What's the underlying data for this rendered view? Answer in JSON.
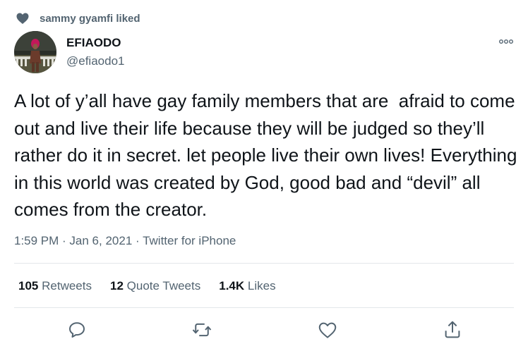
{
  "social_context": {
    "text": "sammy gyamfi liked",
    "icon": "heart-icon"
  },
  "author": {
    "name": "EFIAODO",
    "handle": "@efiaodo1"
  },
  "tweet": {
    "text": "A lot of y’all have gay family members that are  afraid to come out and live their life because they will be judged so they’ll rather do it in secret. let people live their own lives! Everything in this world was created by God, good bad and “devil” all comes from the creator."
  },
  "meta": {
    "text": "1:59 PM · Jan 6, 2021 · Twitter for iPhone"
  },
  "stats": [
    {
      "count": "105",
      "label": "Retweets"
    },
    {
      "count": "12",
      "label": "Quote Tweets"
    },
    {
      "count": "1.4K",
      "label": "Likes"
    }
  ],
  "actions": [
    "reply-icon",
    "retweet-icon",
    "like-icon",
    "share-icon"
  ],
  "colors": {
    "primary_text": "#0f1419",
    "secondary_text": "#536471",
    "divider": "#e3e7ea"
  }
}
